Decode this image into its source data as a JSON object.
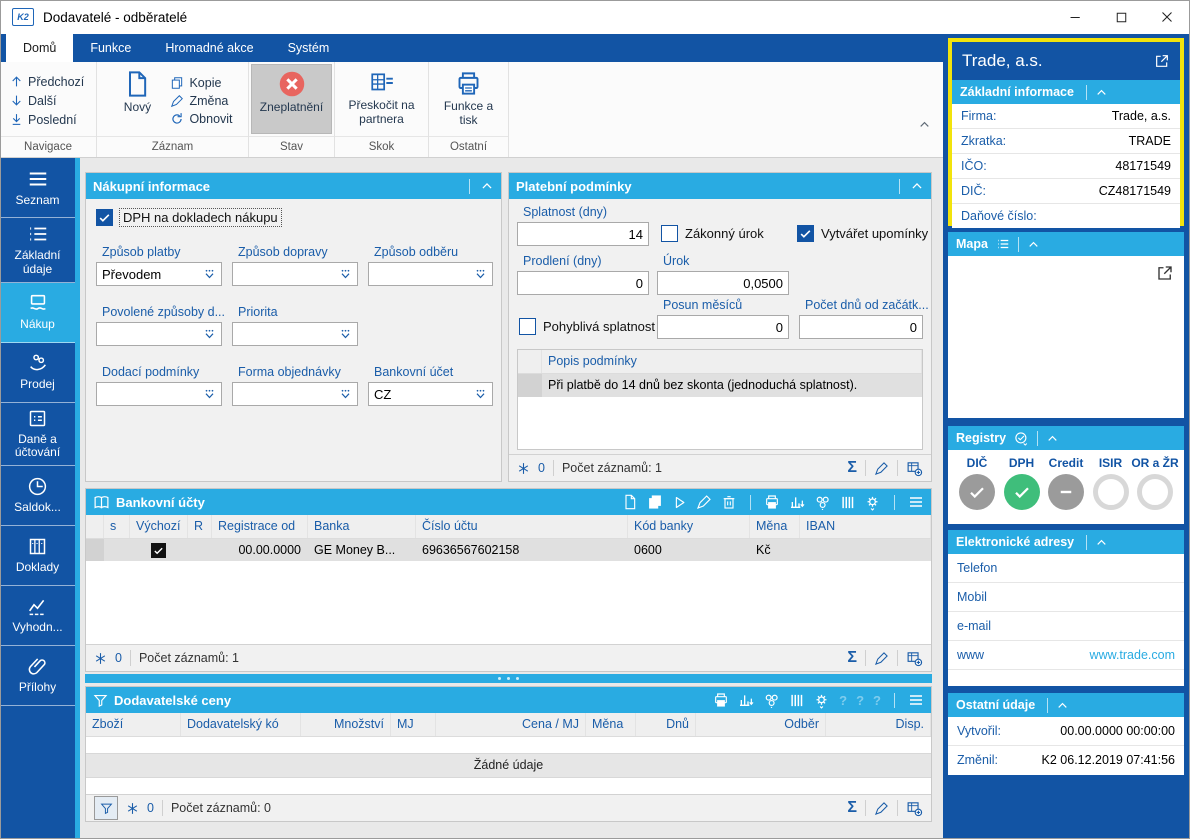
{
  "win": {
    "title": "Dodavatelé - odběratelé",
    "logo": "K2"
  },
  "tabs": {
    "items": [
      {
        "label": "Domů",
        "active": true
      },
      {
        "label": "Funkce",
        "active": false
      },
      {
        "label": "Hromadné akce",
        "active": false
      },
      {
        "label": "Systém",
        "active": false
      }
    ]
  },
  "ribbon": {
    "navigace": {
      "caption": "Navigace",
      "prev": "Předchozí",
      "next": "Další",
      "last": "Poslední"
    },
    "zaznam": {
      "caption": "Záznam",
      "new": "Nový",
      "copy": "Kopie",
      "change": "Změna",
      "refresh": "Obnovit"
    },
    "stav": {
      "caption": "Stav",
      "invalidate": "Zneplatnění"
    },
    "skok": {
      "caption": "Skok",
      "jump": "Přeskočit na partnera"
    },
    "ostatni": {
      "caption": "Ostatní",
      "funcs": "Funkce a tisk"
    }
  },
  "sidebar": {
    "items": [
      {
        "label": "Seznam",
        "active": false
      },
      {
        "label": "Základní údaje",
        "active": false
      },
      {
        "label": "Nákup",
        "active": true
      },
      {
        "label": "Prodej",
        "active": false
      },
      {
        "label": "Daně a účtování",
        "active": false
      },
      {
        "label": "Saldok...",
        "active": false
      },
      {
        "label": "Doklady",
        "active": false
      },
      {
        "label": "Vyhodn...",
        "active": false
      },
      {
        "label": "Přílohy",
        "active": false
      }
    ]
  },
  "purchase": {
    "title": "Nákupní informace",
    "dph": {
      "label": "DPH na dokladech nákupu",
      "checked": true
    },
    "fields": [
      {
        "label": "Způsob platby",
        "value": "Převodem"
      },
      {
        "label": "Způsob dopravy",
        "value": ""
      },
      {
        "label": "Způsob odběru",
        "value": ""
      },
      {
        "label": "Povolené způsoby d...",
        "value": ""
      },
      {
        "label": "Priorita",
        "value": ""
      },
      {
        "label": "Dodací podmínky",
        "value": ""
      },
      {
        "label": "Forma objednávky",
        "value": ""
      },
      {
        "label": "Bankovní účet",
        "value": "CZ"
      }
    ]
  },
  "payment": {
    "title": "Platební podmínky",
    "due_label": "Splatnost (dny)",
    "due_value": "14",
    "legal_interest": {
      "label": "Zákonný úrok",
      "checked": false
    },
    "reminders": {
      "label": "Vytvářet upomínky",
      "checked": true
    },
    "delay_label": "Prodlení (dny)",
    "delay_value": "0",
    "interest_label": "Úrok",
    "interest_value": "0,0500",
    "floating": {
      "label": "Pohyblivá splatnost",
      "checked": false
    },
    "month_shift_label": "Posun měsíců",
    "month_shift_value": "0",
    "days_from_label": "Počet dnů od začátk...",
    "days_from_value": "0",
    "grid_header": "Popis podmínky",
    "grid_row": "Při platbě do 14 dnů bez skonta (jednoduchá splatnost).",
    "footer": {
      "changes": "0",
      "records": "Počet záznamů: 1"
    }
  },
  "bank": {
    "title": "Bankovní účty",
    "columns": [
      "s",
      "Výchozí",
      "R",
      "Registrace od",
      "Banka",
      "Číslo účtu",
      "Kód banky",
      "Měna",
      "IBAN"
    ],
    "row": {
      "default_checked": true,
      "registrace": "00.00.0000",
      "banka": "GE Money B...",
      "ucet": "69636567602158",
      "kod": "0600",
      "mena": "Kč",
      "iban": ""
    },
    "footer": {
      "changes": "0",
      "records": "Počet záznamů: 1"
    }
  },
  "prices": {
    "title": "Dodavatelské ceny",
    "columns": [
      "Zboží",
      "Dodavatelský kó",
      "Množství",
      "MJ",
      "Cena / MJ",
      "Měna",
      "Dnů",
      "Odběr",
      "Disp."
    ],
    "empty": "Žádné údaje",
    "footer": {
      "changes": "0",
      "records": "Počet záznamů: 0"
    }
  },
  "detail": {
    "company": "Trade, a.s.",
    "basic": {
      "title": "Základní informace",
      "rows": [
        {
          "label": "Firma:",
          "value": "Trade, a.s."
        },
        {
          "label": "Zkratka:",
          "value": "TRADE"
        },
        {
          "label": "IČO:",
          "value": "48171549"
        },
        {
          "label": "DIČ:",
          "value": "CZ48171549"
        },
        {
          "label": "Daňové číslo:",
          "value": ""
        }
      ]
    },
    "map": {
      "title": "Mapa"
    },
    "registry": {
      "title": "Registry",
      "items": [
        {
          "label": "DIČ",
          "status": "gray-check"
        },
        {
          "label": "DPH",
          "status": "green-check"
        },
        {
          "label": "Credit",
          "status": "gray-dash"
        },
        {
          "label": "ISIR",
          "status": "empty"
        },
        {
          "label": "OR a ŽR",
          "status": "empty"
        }
      ]
    },
    "eaddr": {
      "title": "Elektronické adresy",
      "rows": [
        {
          "label": "Telefon",
          "value": ""
        },
        {
          "label": "Mobil",
          "value": ""
        },
        {
          "label": "e-mail",
          "value": ""
        },
        {
          "label": "www",
          "value": "www.trade.com"
        }
      ]
    },
    "other": {
      "title": "Ostatní údaje",
      "rows": [
        {
          "label": "Vytvořil:",
          "value": "00.00.0000 00:00:00"
        },
        {
          "label": "Změnil:",
          "value": "K2 06.12.2019 07:41:56"
        }
      ]
    }
  },
  "colors": {
    "accent": "#1254a4",
    "cyan": "#29abe2",
    "yellow": "#f2e30c",
    "green": "#3fbe7b",
    "red": "#e8655f",
    "link": "#29abe2"
  }
}
